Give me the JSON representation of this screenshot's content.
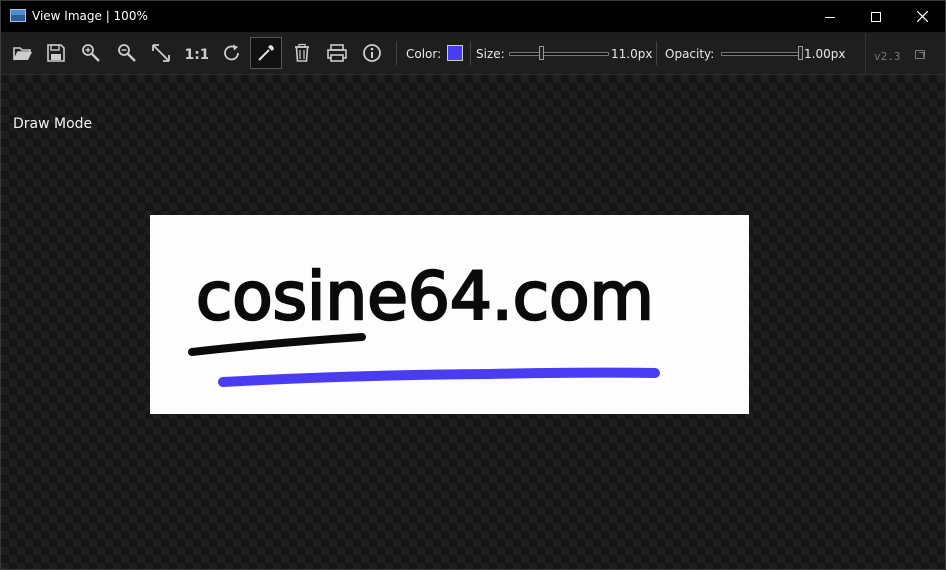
{
  "window": {
    "title": "View Image | 100%"
  },
  "toolbar": {
    "buttons": [
      {
        "name": "open-icon"
      },
      {
        "name": "save-icon"
      },
      {
        "name": "zoom-in-icon"
      },
      {
        "name": "zoom-out-icon"
      },
      {
        "name": "fit-window-icon"
      },
      {
        "name": "actual-size-icon",
        "glyph": "1:1"
      },
      {
        "name": "rotate-icon"
      },
      {
        "name": "eyedropper-icon",
        "active": true
      },
      {
        "name": "trash-icon"
      },
      {
        "name": "print-icon"
      },
      {
        "name": "info-icon"
      }
    ],
    "color_label": "Color:",
    "color_value": "#4a3cf2",
    "size_label": "Size:",
    "size_value": "11.0px",
    "size_fraction": 0.32,
    "opacity_label": "Opacity:",
    "opacity_value": "1.00px",
    "opacity_fraction": 1.0,
    "version": "v2.3"
  },
  "canvas": {
    "mode_label": "Draw Mode",
    "image_text": "cosine64.com",
    "stroke_color": "#4a3cf2"
  }
}
